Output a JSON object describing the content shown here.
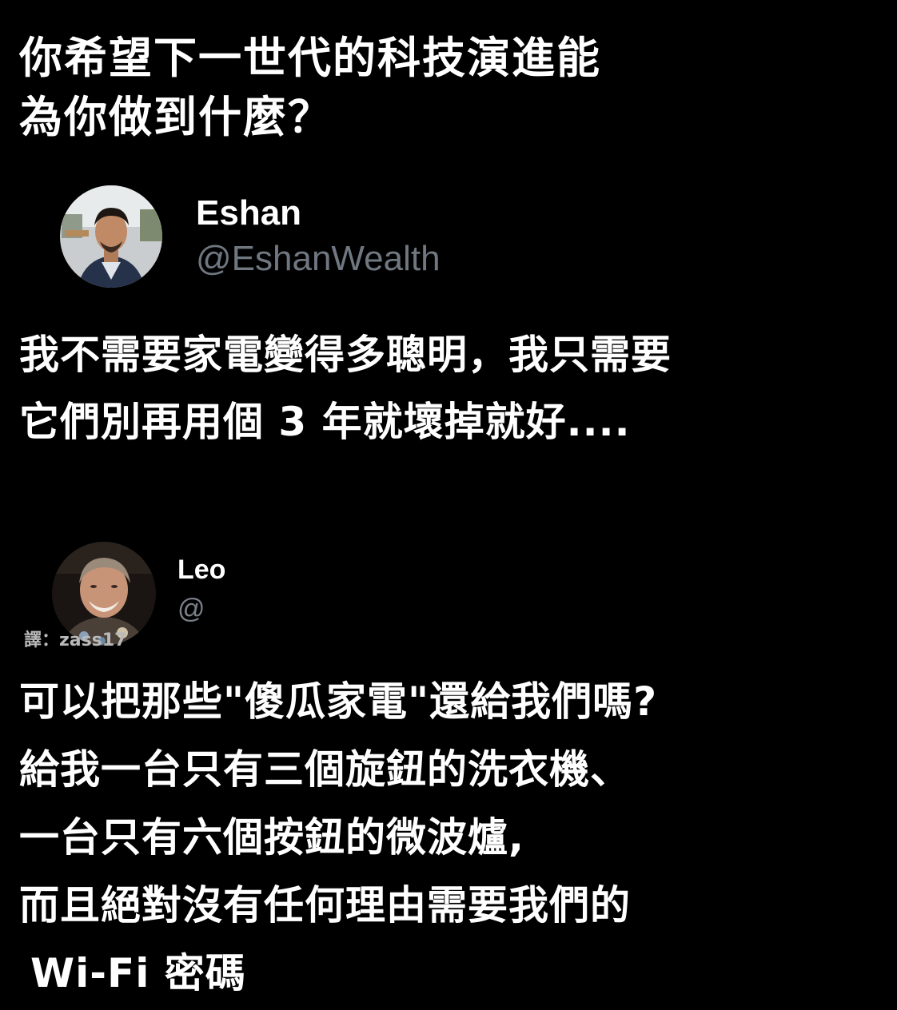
{
  "question": {
    "lines": [
      "你希望下一世代的科技演進能",
      "為你做到什麼？"
    ]
  },
  "tweets": [
    {
      "display_name": "Eshan",
      "handle": "@EshanWealth",
      "text_lines": [
        "我不需要家電變得多聰明，我只需要",
        "它們別再用個 3 年就壞掉就好...."
      ]
    },
    {
      "display_name": "Leo",
      "handle": "@",
      "text_lines": [
        "可以把那些\"傻瓜家電\"還給我們嗎?",
        "給我一台只有三個旋鈕的洗衣機、",
        "一台只有六個按鈕的微波爐,",
        "而且絕對沒有任何理由需要我們的",
        "Wi-Fi 密碼"
      ]
    }
  ],
  "translator_credit": "譯：zass17",
  "colors": {
    "background": "#000000",
    "text": "#ffffff",
    "handle": "#6f7780",
    "credit": "#b9b9b9"
  },
  "icons": [
    "eshan-avatar",
    "leo-avatar"
  ]
}
